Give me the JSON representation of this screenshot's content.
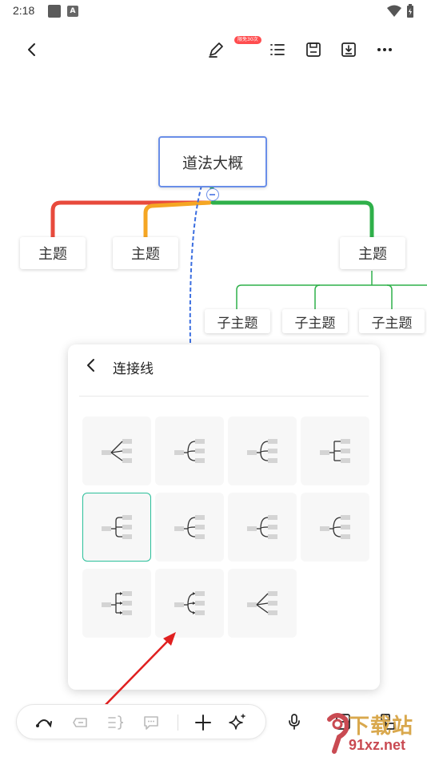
{
  "status_bar": {
    "time": "2:18"
  },
  "toolbar": {
    "badge": "限免30次"
  },
  "mindmap": {
    "central": "道法大概",
    "topics": [
      "主题",
      "主题",
      "主题"
    ],
    "subtopics": [
      "子主题",
      "子主题",
      "子主题"
    ]
  },
  "panel": {
    "title": "连接线",
    "selected_index": 4,
    "option_count": 11
  },
  "watermark": {
    "line1": "下载站",
    "line2": "91xz.net"
  },
  "colors": {
    "accent": "#2bbf9a",
    "main_border": "#6a8ee8",
    "red": "#e84a3c",
    "orange": "#f5a623",
    "green": "#2fb04a",
    "blue_dash": "#3b6ee0",
    "arrow": "#e02020"
  }
}
